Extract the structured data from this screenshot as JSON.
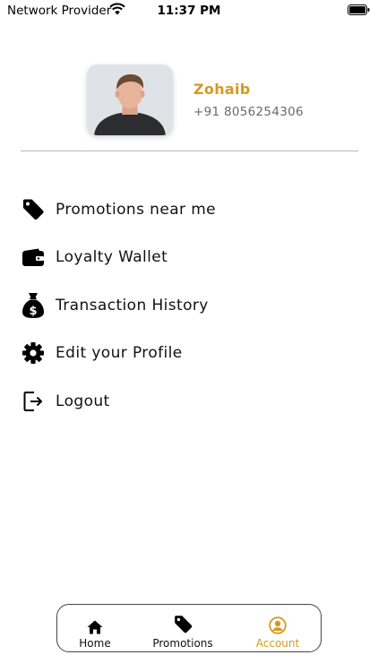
{
  "status_bar": {
    "carrier": "Network Provider",
    "time": "11:37 PM"
  },
  "profile": {
    "name": "Zohaib",
    "phone": "+91 8056254306"
  },
  "menu": {
    "items": [
      {
        "label": "Promotions near me",
        "icon": "tag-icon"
      },
      {
        "label": "Loyalty Wallet",
        "icon": "wallet-icon"
      },
      {
        "label": "Transaction History",
        "icon": "money-bag-icon"
      },
      {
        "label": "Edit your Profile",
        "icon": "gear-icon"
      },
      {
        "label": "Logout",
        "icon": "logout-icon"
      }
    ]
  },
  "bottom_nav": {
    "items": [
      {
        "label": "Home",
        "icon": "home-icon"
      },
      {
        "label": "Promotions",
        "icon": "tag-icon"
      },
      {
        "label": "Account",
        "icon": "account-icon",
        "active": true
      }
    ]
  },
  "colors": {
    "accent": "#d39a1f",
    "text": "#111111",
    "muted": "#6a6a6a"
  }
}
